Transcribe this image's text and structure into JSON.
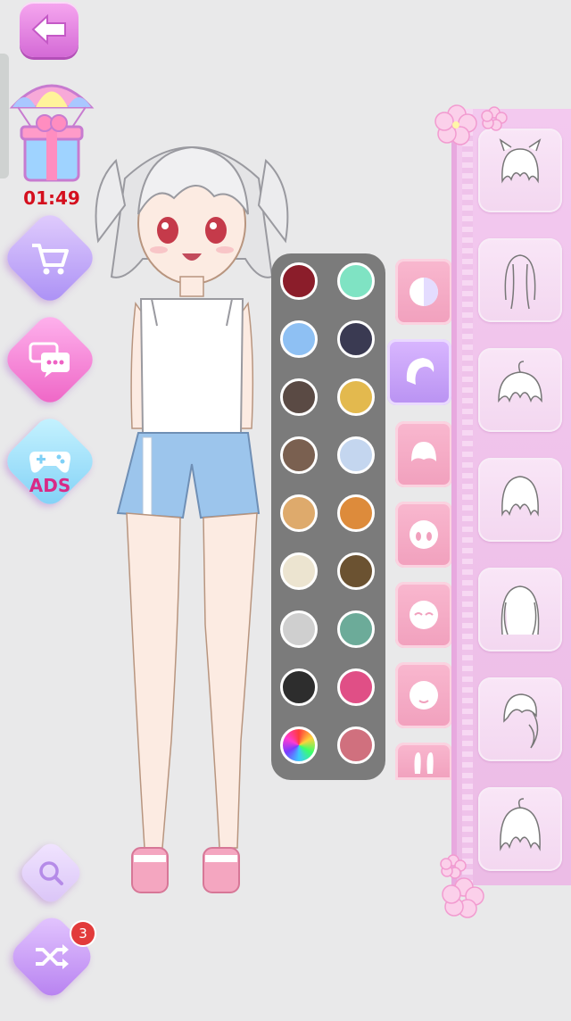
{
  "timer": {
    "value": "01:49"
  },
  "left_menu": {
    "back_icon": "arrow-left-icon",
    "gift_icon": "parachute-gift-icon",
    "shop_icon": "shopping-cart-icon",
    "chat_icon": "chat-bubbles-icon",
    "ads_icon": "gamepad-icon",
    "ads_label": "ADS"
  },
  "bottom_menu": {
    "zoom_icon": "magnifier-icon",
    "shuffle_icon": "shuffle-icon",
    "shuffle_badge": "3"
  },
  "palette": {
    "colors": [
      "#8b1d2a",
      "#7fe3c3",
      "#8ec0f3",
      "#3a3a52",
      "#5a4a44",
      "#e3b94e",
      "#7a6050",
      "#c4d6ef",
      "#deaa6c",
      "#dd8b3b",
      "#ece4d0",
      "#6b5231",
      "#cfcfcf",
      "#6cab99",
      "#2d2d2d",
      "#e04f86",
      "rainbow",
      "#d0707e"
    ]
  },
  "categories": [
    {
      "name": "skin-tone",
      "icon": "skin-tone-icon",
      "active": false
    },
    {
      "name": "hair",
      "icon": "hair-icon",
      "active": true
    },
    {
      "name": "hairstyle",
      "icon": "hairstyle-icon",
      "active": false
    },
    {
      "name": "eyes",
      "icon": "eyes-face-icon",
      "active": false
    },
    {
      "name": "eyebrows",
      "icon": "happy-face-icon",
      "active": false
    },
    {
      "name": "mouth",
      "icon": "mouth-face-icon",
      "active": false
    },
    {
      "name": "ears",
      "icon": "ears-icon",
      "active": false
    }
  ],
  "hair_options": [
    {
      "name": "cat-ear-bob",
      "icon": "cat-ear-hair-icon"
    },
    {
      "name": "long-straight",
      "icon": "long-hair-icon"
    },
    {
      "name": "ahoge-bob",
      "icon": "ahoge-hair-icon"
    },
    {
      "name": "short-layered",
      "icon": "short-hair-icon"
    },
    {
      "name": "medium-wavy",
      "icon": "wavy-hair-icon"
    },
    {
      "name": "side-ponytail",
      "icon": "side-tail-hair-icon"
    },
    {
      "name": "short-ahoge",
      "icon": "short-ahoge-hair-icon"
    }
  ]
}
